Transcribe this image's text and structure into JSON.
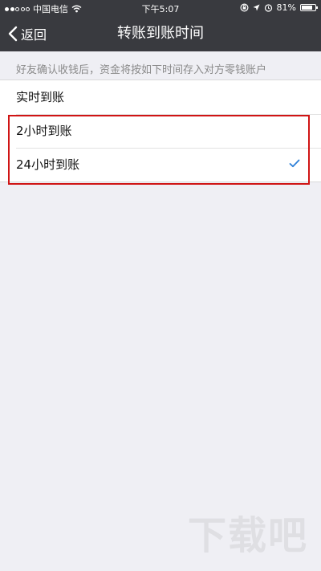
{
  "status_bar": {
    "carrier": "中国电信",
    "time": "下午5:07",
    "battery": "81%",
    "battery_level": 0.81,
    "icons": [
      "signal-icon",
      "wifi-icon",
      "rotation-lock-icon",
      "location-icon",
      "alarm-icon",
      "battery-icon"
    ]
  },
  "nav": {
    "back_label": "返回",
    "title": "转账到账时间"
  },
  "description": "好友确认收钱后，资金将按如下时间存入对方零钱账户",
  "options": [
    {
      "label": "实时到账",
      "selected": false
    },
    {
      "label": "2小时到账",
      "selected": false
    },
    {
      "label": "24小时到账",
      "selected": true
    }
  ],
  "colors": {
    "nav_background": "#393a3f",
    "page_background": "#efeff4",
    "check_color": "#2b7fd8",
    "highlight_border": "#d01414"
  },
  "watermark": "下载吧"
}
